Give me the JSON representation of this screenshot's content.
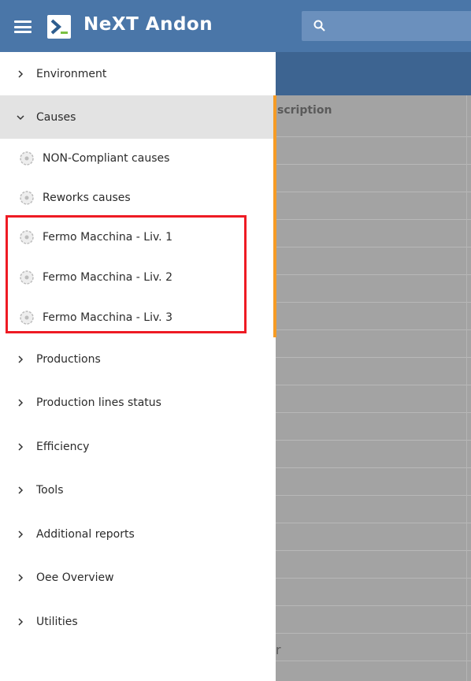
{
  "header": {
    "app_title": "NeXT Andon"
  },
  "content": {
    "column_header": "scription",
    "stray_char": "r"
  },
  "sidebar": {
    "items": [
      {
        "label": "Environment"
      },
      {
        "label": "Causes",
        "expanded": true,
        "children": [
          {
            "label": "NON-Compliant causes"
          },
          {
            "label": "Reworks causes"
          },
          {
            "label": "Fermo Macchina - Liv. 1"
          },
          {
            "label": "Fermo Macchina - Liv. 2"
          },
          {
            "label": "Fermo Macchina - Liv. 3"
          }
        ]
      },
      {
        "label": "Productions"
      },
      {
        "label": "Production lines status"
      },
      {
        "label": "Efficiency"
      },
      {
        "label": "Tools"
      },
      {
        "label": "Additional reports"
      },
      {
        "label": "Oee Overview"
      },
      {
        "label": "Utilities"
      }
    ]
  },
  "colors": {
    "header": "#4a76a8",
    "accent": "#f59b25",
    "highlight": "#ee1b24"
  }
}
